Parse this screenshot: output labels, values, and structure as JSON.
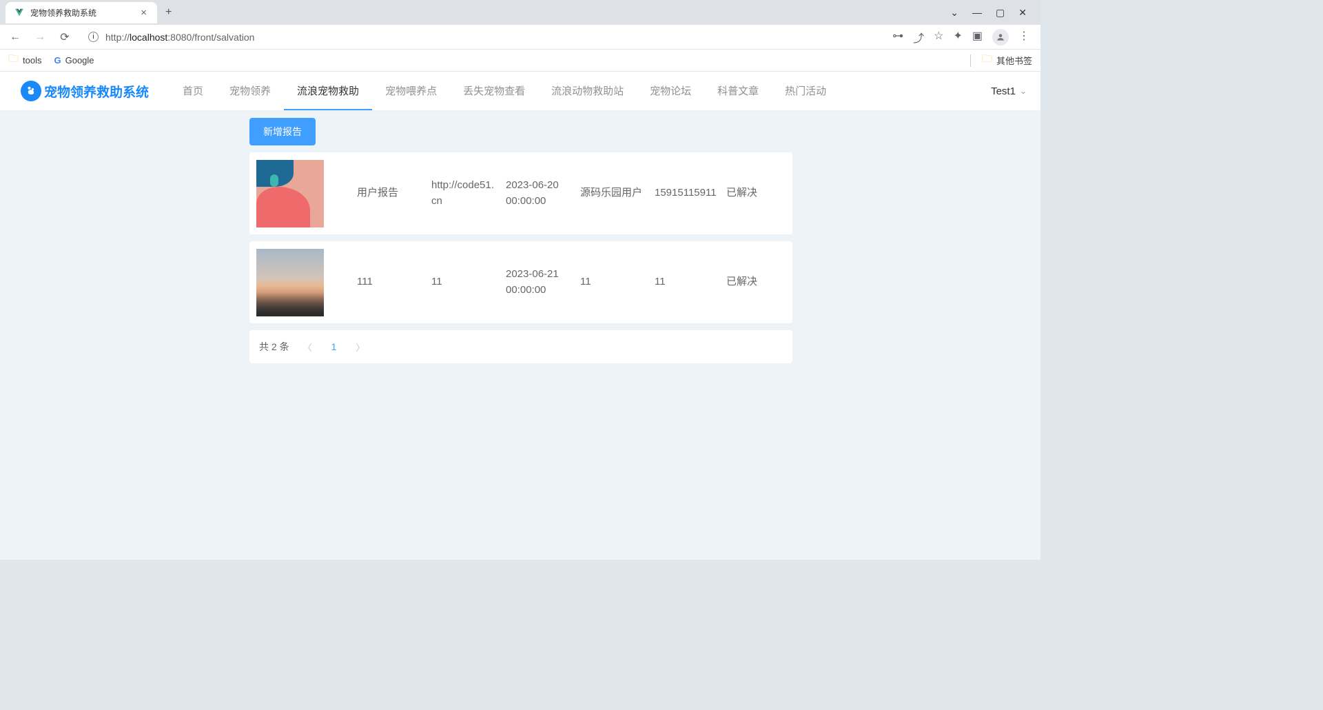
{
  "browser": {
    "tab_title": "宠物领养救助系统",
    "url_prefix": "http://",
    "url_host": "localhost",
    "url_port": ":8080",
    "url_path": "/front/salvation",
    "bookmarks": [
      {
        "label": "tools",
        "type": "folder"
      },
      {
        "label": "Google",
        "type": "g"
      }
    ],
    "other_bookmarks": "其他书签"
  },
  "header": {
    "logo_text": "宠物领养救助系统",
    "nav": [
      {
        "label": "首页"
      },
      {
        "label": "宠物领养"
      },
      {
        "label": "流浪宠物救助",
        "active": true
      },
      {
        "label": "宠物喂养点"
      },
      {
        "label": "丢失宠物查看"
      },
      {
        "label": "流浪动物救助站"
      },
      {
        "label": "宠物论坛"
      },
      {
        "label": "科普文章"
      },
      {
        "label": "热门活动"
      }
    ],
    "user": "Test1"
  },
  "actions": {
    "add_report": "新增报告"
  },
  "rows": [
    {
      "thumb": "abstract",
      "title": "用户报告",
      "link": "http://code51.cn",
      "time": "2023-06-20 00:00:00",
      "author": "源码乐园用户",
      "phone": "15915115911",
      "status": "已解决"
    },
    {
      "thumb": "sunset",
      "title": "111",
      "link": "11",
      "time": "2023-06-21 00:00:00",
      "author": "11",
      "phone": "11",
      "status": "已解决"
    }
  ],
  "pagination": {
    "total_text": "共 2 条",
    "current": "1"
  }
}
